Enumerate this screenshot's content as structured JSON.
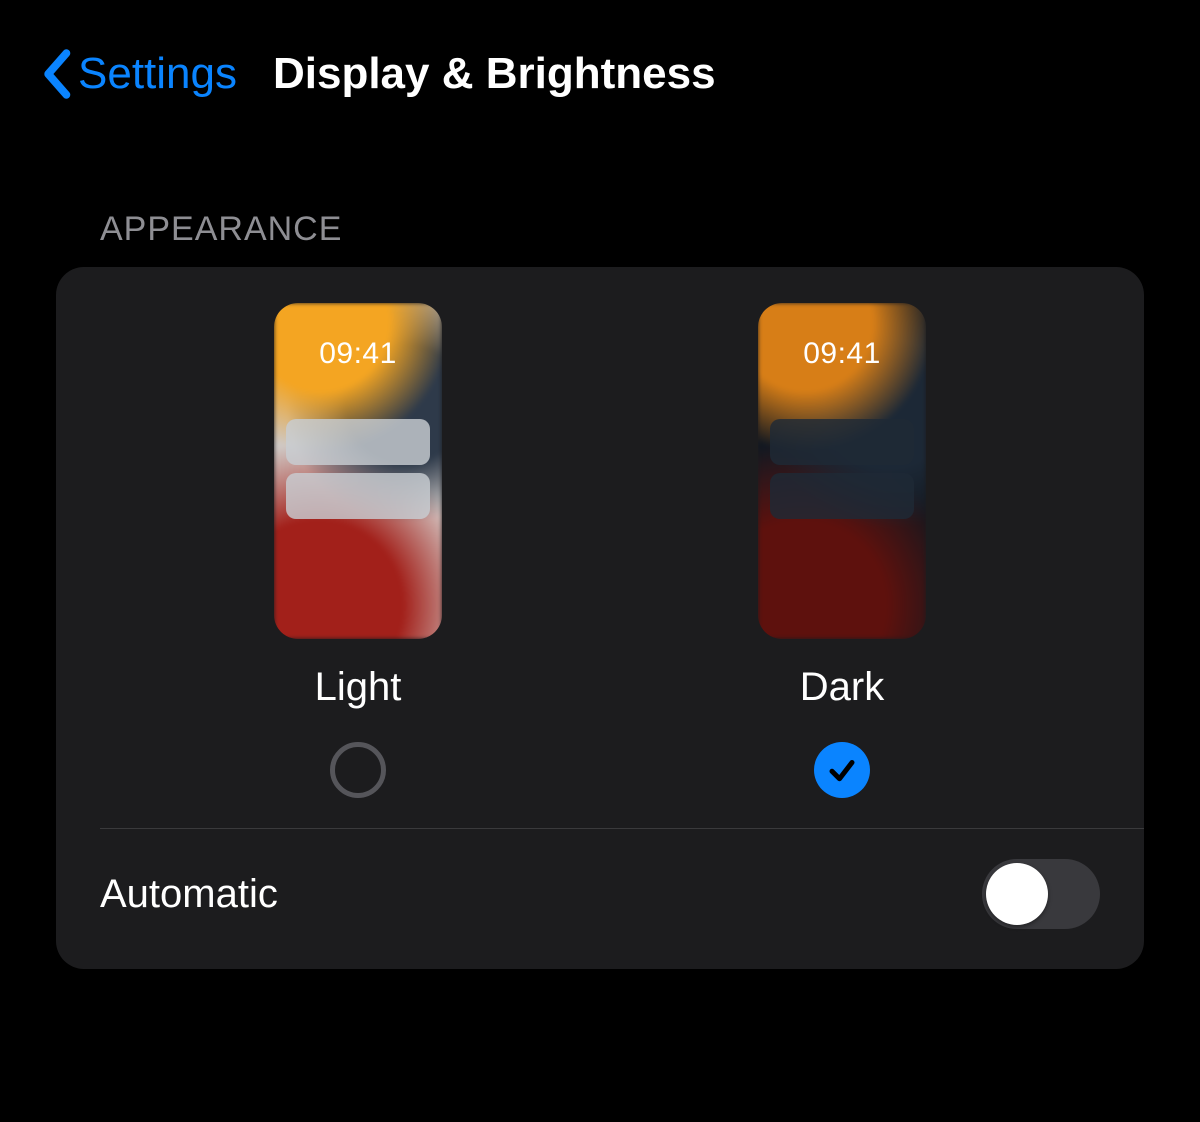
{
  "nav": {
    "back_label": "Settings",
    "title": "Display & Brightness"
  },
  "section": {
    "header": "APPEARANCE"
  },
  "appearance": {
    "preview_time": "09:41",
    "options": [
      {
        "label": "Light",
        "selected": false
      },
      {
        "label": "Dark",
        "selected": true
      }
    ]
  },
  "automatic": {
    "label": "Automatic",
    "enabled": false
  },
  "colors": {
    "accent": "#0a84ff"
  }
}
